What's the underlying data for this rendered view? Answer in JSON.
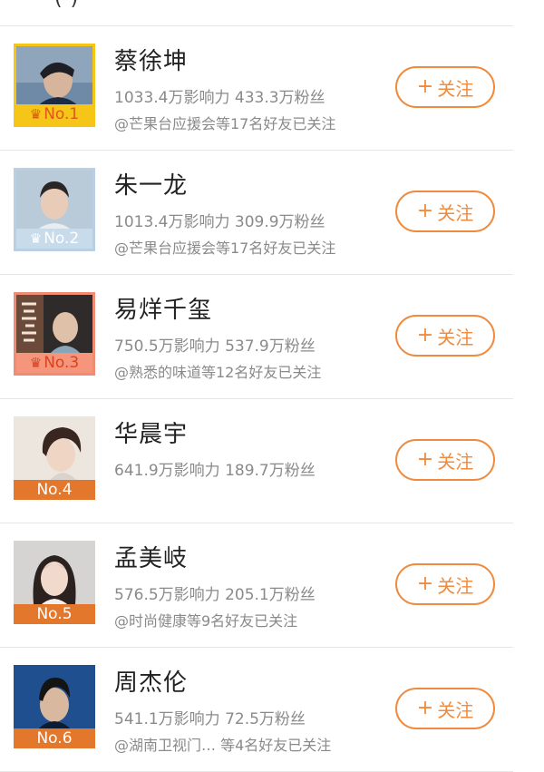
{
  "header": {
    "partial_text": "(    )"
  },
  "follow_label": "关注",
  "follow_icon": "plus-icon",
  "colors": {
    "accent": "#f08b3e",
    "rank1": "#f5c518",
    "rank2": "#b9d0e4",
    "rank3": "#f08c74",
    "rank_other": "#e3782c"
  },
  "rows": [
    {
      "rank": "No.1",
      "name": "蔡徐坤",
      "influence": "1033.4万影响力",
      "fans": "433.3万粉丝",
      "friends": "@芒果台应援会等17名好友已关注"
    },
    {
      "rank": "No.2",
      "name": "朱一龙",
      "influence": "1013.4万影响力",
      "fans": "309.9万粉丝",
      "friends": "@芒果台应援会等17名好友已关注"
    },
    {
      "rank": "No.3",
      "name": "易烊千玺",
      "influence": "750.5万影响力",
      "fans": "537.9万粉丝",
      "friends": "@熟悉的味道等12名好友已关注"
    },
    {
      "rank": "No.4",
      "name": "华晨宇",
      "influence": "641.9万影响力",
      "fans": "189.7万粉丝",
      "friends": ""
    },
    {
      "rank": "No.5",
      "name": "孟美岐",
      "influence": "576.5万影响力",
      "fans": "205.1万粉丝",
      "friends": "@时尚健康等9名好友已关注"
    },
    {
      "rank": "No.6",
      "name": "周杰伦",
      "influence": "541.1万影响力",
      "fans": "72.5万粉丝",
      "friends": "@湖南卫视门… 等4名好友已关注"
    }
  ]
}
